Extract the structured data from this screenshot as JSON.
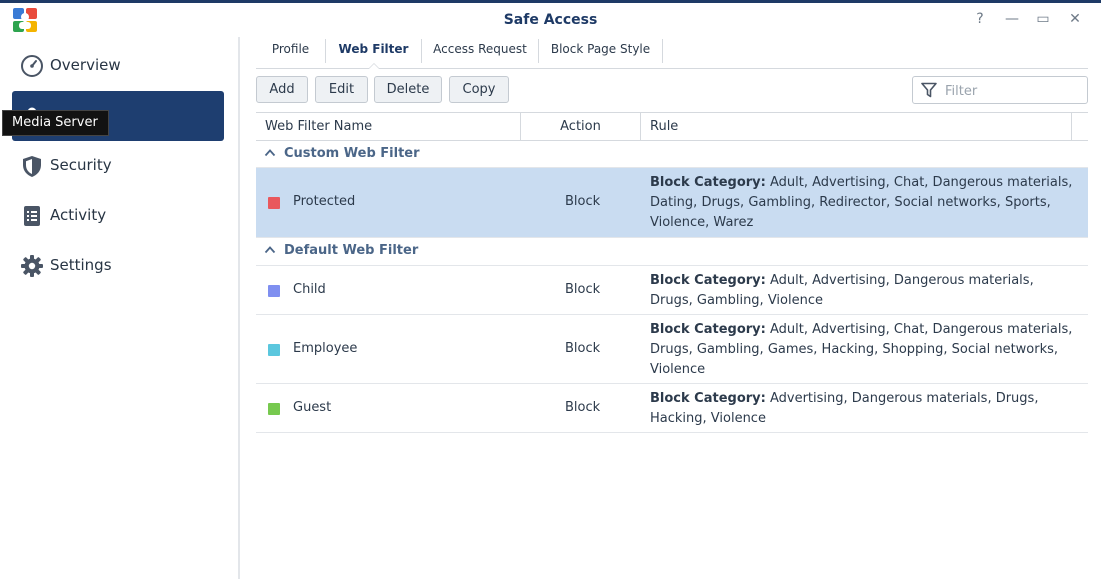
{
  "window": {
    "title": "Safe Access",
    "controls": {
      "help": "?",
      "minimize": "—",
      "maximize": "▭",
      "close": "✕"
    }
  },
  "sidebar": {
    "items": [
      {
        "label": "Overview",
        "icon": "overview-gauge-icon"
      },
      {
        "label": "",
        "icon": "profile-user-icon",
        "active": true
      },
      {
        "label": "Security",
        "icon": "shield-icon"
      },
      {
        "label": "Activity",
        "icon": "activity-list-icon"
      },
      {
        "label": "Settings",
        "icon": "gear-icon"
      }
    ],
    "tooltip": "Media Server"
  },
  "tabs": [
    {
      "label": "Profile"
    },
    {
      "label": "Web Filter",
      "active": true
    },
    {
      "label": "Access Request"
    },
    {
      "label": "Block Page Style"
    }
  ],
  "toolbar": {
    "add": "Add",
    "edit": "Edit",
    "delete": "Delete",
    "copy": "Copy",
    "filter_placeholder": "Filter"
  },
  "grid": {
    "columns": [
      "Web Filter Name",
      "Action",
      "Rule"
    ],
    "rule_prefix": "Block Category:",
    "groups": [
      {
        "label": "Custom Web Filter",
        "rows": [
          {
            "name": "Protected",
            "color": "#e9585d",
            "action": "Block",
            "rule": "Adult, Advertising, Chat, Dangerous materials, Dating, Drugs, Gambling, Redirector, Social networks, Sports, Violence, Warez",
            "selected": true
          }
        ]
      },
      {
        "label": "Default Web Filter",
        "rows": [
          {
            "name": "Child",
            "color": "#7f8ff0",
            "action": "Block",
            "rule": "Adult, Advertising, Dangerous materials, Drugs, Gambling, Violence"
          },
          {
            "name": "Employee",
            "color": "#5bc7de",
            "action": "Block",
            "rule": "Adult, Advertising, Chat, Dangerous materials, Drugs, Gambling, Games, Hacking, Shopping, Social networks, Violence"
          },
          {
            "name": "Guest",
            "color": "#77c94f",
            "action": "Block",
            "rule": "Advertising, Dangerous materials, Drugs, Hacking, Violence"
          }
        ]
      }
    ]
  },
  "colors": {
    "accent": "#1e3a66",
    "sidebar_active": "#1e3e70",
    "selected_row": "#c9dcf1"
  }
}
